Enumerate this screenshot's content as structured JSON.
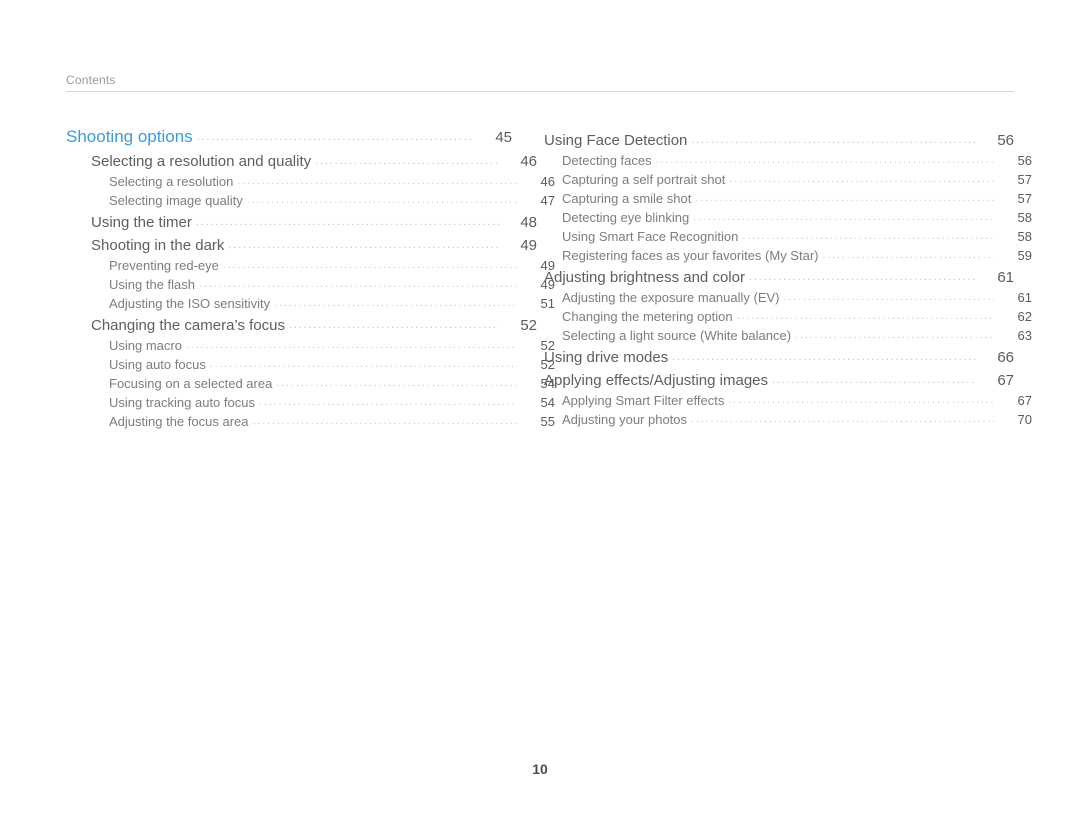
{
  "header": {
    "label": "Contents"
  },
  "footer": {
    "page_number": "10"
  },
  "columns": {
    "left": [
      {
        "level": 0,
        "title": "Shooting options",
        "page": "45"
      },
      {
        "level": 1,
        "title": "Selecting a resolution and quality",
        "page": "46"
      },
      {
        "level": 2,
        "title": "Selecting a resolution",
        "page": "46"
      },
      {
        "level": 2,
        "title": "Selecting image quality",
        "page": "47"
      },
      {
        "level": 1,
        "title": "Using the timer",
        "page": "48"
      },
      {
        "level": 1,
        "title": "Shooting in the dark",
        "page": "49"
      },
      {
        "level": 2,
        "title": "Preventing red-eye",
        "page": "49"
      },
      {
        "level": 2,
        "title": "Using the flash",
        "page": "49"
      },
      {
        "level": 2,
        "title": "Adjusting the ISO sensitivity",
        "page": "51"
      },
      {
        "level": 1,
        "title": "Changing the camera’s focus",
        "page": "52"
      },
      {
        "level": 2,
        "title": "Using macro",
        "page": "52"
      },
      {
        "level": 2,
        "title": "Using auto focus",
        "page": "52"
      },
      {
        "level": 2,
        "title": "Focusing on a selected area",
        "page": "54"
      },
      {
        "level": 2,
        "title": "Using tracking auto focus",
        "page": "54"
      },
      {
        "level": 2,
        "title": "Adjusting the focus area",
        "page": "55"
      }
    ],
    "right": [
      {
        "level": 1,
        "title": "Using Face Detection",
        "page": "56"
      },
      {
        "level": 2,
        "title": "Detecting faces",
        "page": "56"
      },
      {
        "level": 2,
        "title": "Capturing a self portrait shot",
        "page": "57"
      },
      {
        "level": 2,
        "title": "Capturing a smile shot",
        "page": "57"
      },
      {
        "level": 2,
        "title": "Detecting eye blinking",
        "page": "58"
      },
      {
        "level": 2,
        "title": "Using Smart Face Recognition",
        "page": "58"
      },
      {
        "level": 2,
        "title": "Registering faces as your favorites (My Star)",
        "page": "59"
      },
      {
        "level": 1,
        "title": "Adjusting brightness and color",
        "page": "61"
      },
      {
        "level": 2,
        "title": "Adjusting the exposure manually (EV)",
        "page": "61"
      },
      {
        "level": 2,
        "title": "Changing the metering option",
        "page": "62"
      },
      {
        "level": 2,
        "title": "Selecting a light source (White balance)",
        "page": "63"
      },
      {
        "level": 1,
        "title": "Using drive modes",
        "page": "66"
      },
      {
        "level": 1,
        "title": "Applying effects/Adjusting images",
        "page": "67"
      },
      {
        "level": 2,
        "title": "Applying Smart Filter effects",
        "page": "67"
      },
      {
        "level": 2,
        "title": "Adjusting your photos",
        "page": "70"
      }
    ]
  }
}
